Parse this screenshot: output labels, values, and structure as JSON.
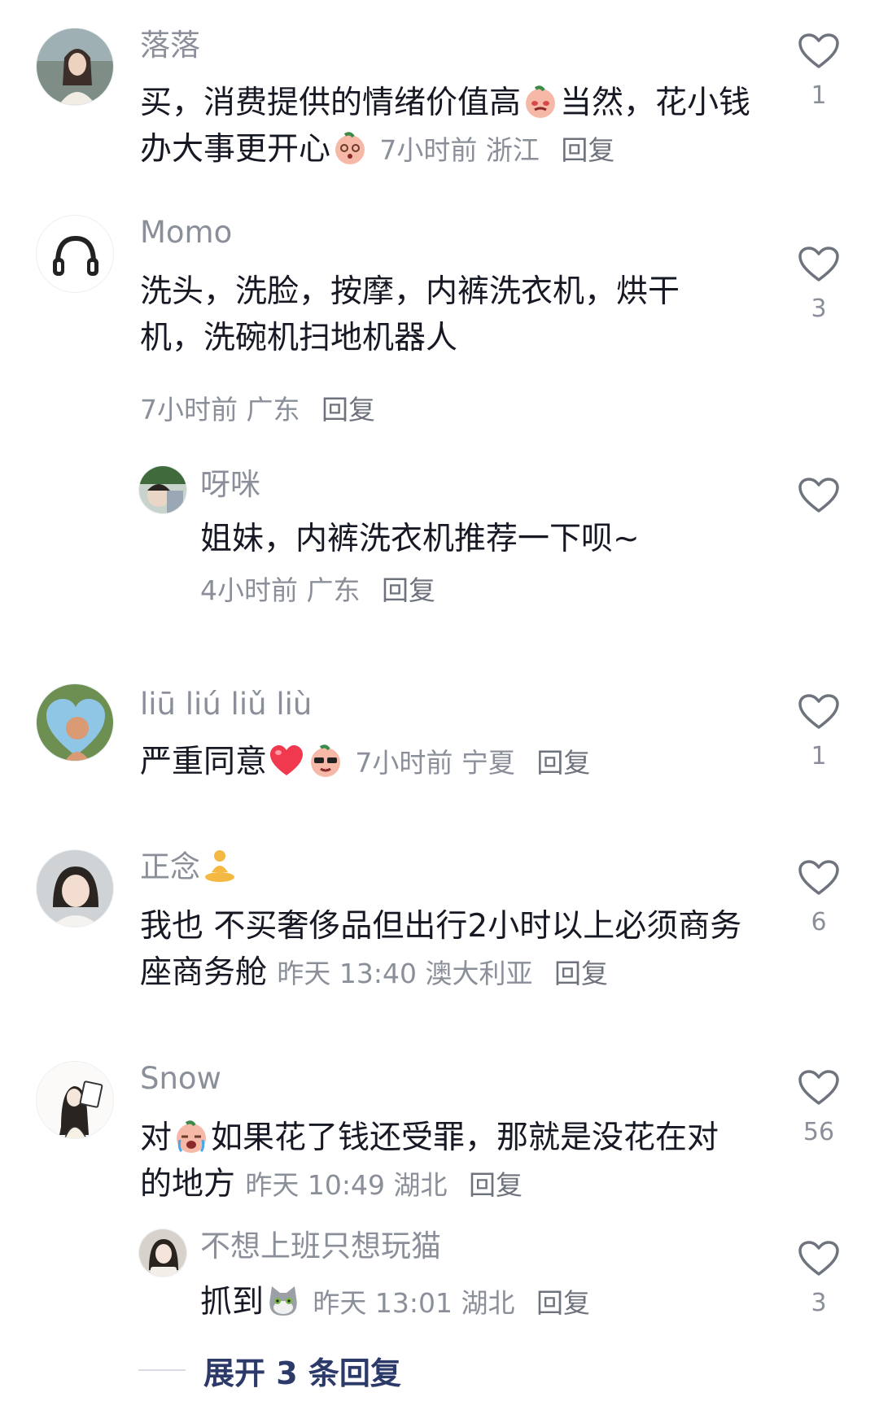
{
  "comments": [
    {
      "name": "落落",
      "text_a": "买，消费提供的情绪价值高",
      "text_b": "当然，花小钱办大事更开心",
      "time": "7小时前",
      "location": "浙江",
      "reply": "回复",
      "likes": "1"
    },
    {
      "name": "Momo",
      "text": "洗头，洗脸，按摩，内裤洗衣机，烘干机，洗碗机扫地机器人",
      "time": "7小时前",
      "location": "广东",
      "reply": "回复",
      "likes": "3",
      "sub": {
        "name": "呀咪",
        "text": "姐妹，内裤洗衣机推荐一下呗~",
        "time": "4小时前",
        "location": "广东",
        "reply": "回复"
      }
    },
    {
      "name": "liū liú liǔ liù",
      "text": "严重同意",
      "time": "7小时前",
      "location": "宁夏",
      "reply": "回复",
      "likes": "1"
    },
    {
      "name": "正念",
      "text": "我也 不买奢侈品但出行2小时以上必须商务座商务舱",
      "time": "昨天 13:40",
      "location": "澳大利亚",
      "reply": "回复",
      "likes": "6"
    },
    {
      "name": "Snow",
      "text_a": "对",
      "text_b": "如果花了钱还受罪，那就是没花在对的地方",
      "time": "昨天 10:49",
      "location": "湖北",
      "reply": "回复",
      "likes": "56",
      "sub": {
        "name": "不想上班只想玩猫",
        "text": "抓到",
        "time": "昨天 13:01",
        "location": "湖北",
        "reply": "回复",
        "likes": "3"
      }
    }
  ],
  "expand_label": "展开 3 条回复",
  "colors": {
    "text": "#161823",
    "secondary": "#8a8f99",
    "expand": "#2c3a6a",
    "heart_stroke": "#6e737d"
  }
}
